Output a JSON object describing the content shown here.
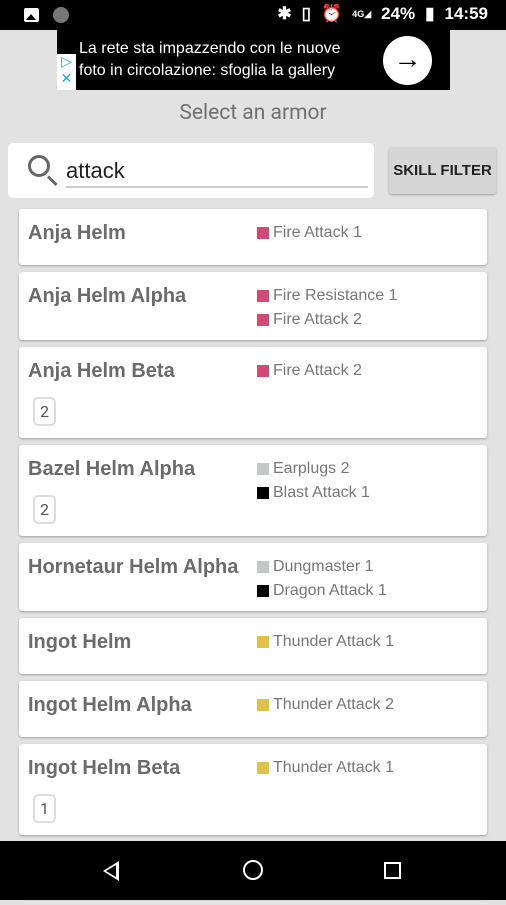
{
  "status": {
    "battery": "24%",
    "time": "14:59",
    "network": "4G"
  },
  "ad": {
    "line1": "La rete sta impazzendo con le nuove",
    "line2": "foto in circolazione: sfoglia la gallery"
  },
  "header": {
    "title": "Select an armor"
  },
  "search": {
    "value": "attack",
    "skill_filter_label": "SKILL FILTER"
  },
  "armors": [
    {
      "name": "Anja Helm",
      "skills": [
        {
          "label": "Fire Attack 1",
          "color": "#d04a74"
        }
      ]
    },
    {
      "name": "Anja Helm Alpha",
      "skills": [
        {
          "label": "Fire Resistance 1",
          "color": "#d04a74"
        },
        {
          "label": "Fire Attack 2",
          "color": "#d04a74"
        }
      ]
    },
    {
      "name": "Anja Helm Beta",
      "skills": [
        {
          "label": "Fire Attack 2",
          "color": "#d04a74"
        }
      ],
      "slots": "2"
    },
    {
      "name": "Bazel Helm Alpha",
      "skills": [
        {
          "label": "Earplugs 2",
          "color": "#c4c9c8"
        },
        {
          "label": "Blast Attack 1",
          "color": "#000000"
        }
      ],
      "slots": "2"
    },
    {
      "name": "Hornetaur Helm Alpha",
      "skills": [
        {
          "label": "Dungmaster 1",
          "color": "#c4c9c8"
        },
        {
          "label": "Dragon Attack 1",
          "color": "#000000"
        }
      ]
    },
    {
      "name": "Ingot Helm",
      "skills": [
        {
          "label": "Thunder Attack 1",
          "color": "#e0c14a"
        }
      ]
    },
    {
      "name": "Ingot Helm Alpha",
      "skills": [
        {
          "label": "Thunder Attack 2",
          "color": "#e0c14a"
        }
      ]
    },
    {
      "name": "Ingot Helm Beta",
      "skills": [
        {
          "label": "Thunder Attack 1",
          "color": "#e0c14a"
        }
      ],
      "slots": "1"
    },
    {
      "name": "",
      "skills": []
    }
  ]
}
